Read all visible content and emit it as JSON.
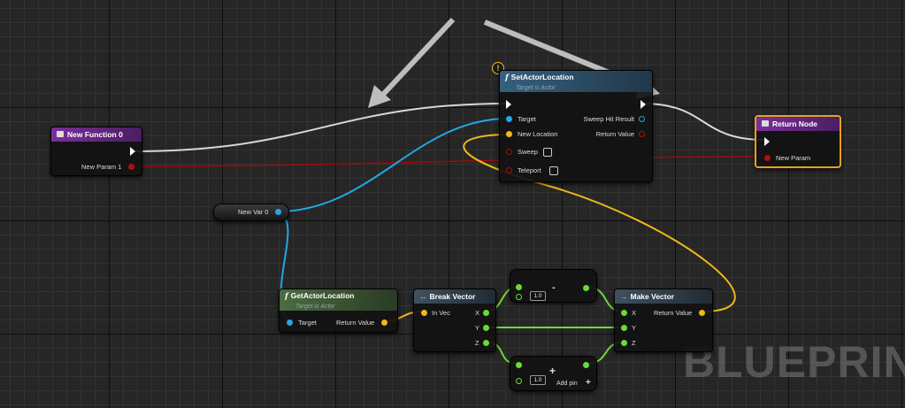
{
  "nodes": {
    "new_function": {
      "title": "New Function 0",
      "param": "New Param 1",
      "color": "#6a2a8c"
    },
    "set_actor_location": {
      "title": "SetActorLocation",
      "subtitle": "Target is Actor",
      "inputs": [
        "Target",
        "New Location",
        "Sweep",
        "Teleport"
      ],
      "outputs": [
        "Sweep Hit Result",
        "Return Value"
      ],
      "color": "#2b4a66",
      "warning_icon": "!"
    },
    "return_node": {
      "title": "Return Node",
      "param": "New Param",
      "color": "#6a2a8c"
    },
    "new_var": {
      "label": "New Var 0"
    },
    "get_actor_location": {
      "title": "GetActorLocation",
      "subtitle": "Target is Actor",
      "target": "Target",
      "return": "Return Value",
      "color": "#3e5b34"
    },
    "break_vector": {
      "title": "Break Vector",
      "input": "In Vec",
      "outputs": [
        "X",
        "Y",
        "Z"
      ]
    },
    "subtract": {
      "symbol": "-",
      "value": "1.0"
    },
    "add": {
      "symbol": "+",
      "value": "1.0",
      "add_pin": "Add pin"
    },
    "make_vector": {
      "title": "Make Vector",
      "inputs": [
        "X",
        "Y",
        "Z"
      ],
      "output": "Return Value"
    }
  },
  "watermark": "BLUEPRIN",
  "colors": {
    "exec": "#ffffff",
    "object": "#22a7e6",
    "vector": "#f0b71c",
    "float": "#6cd93a",
    "bool": "#b00d0d"
  }
}
